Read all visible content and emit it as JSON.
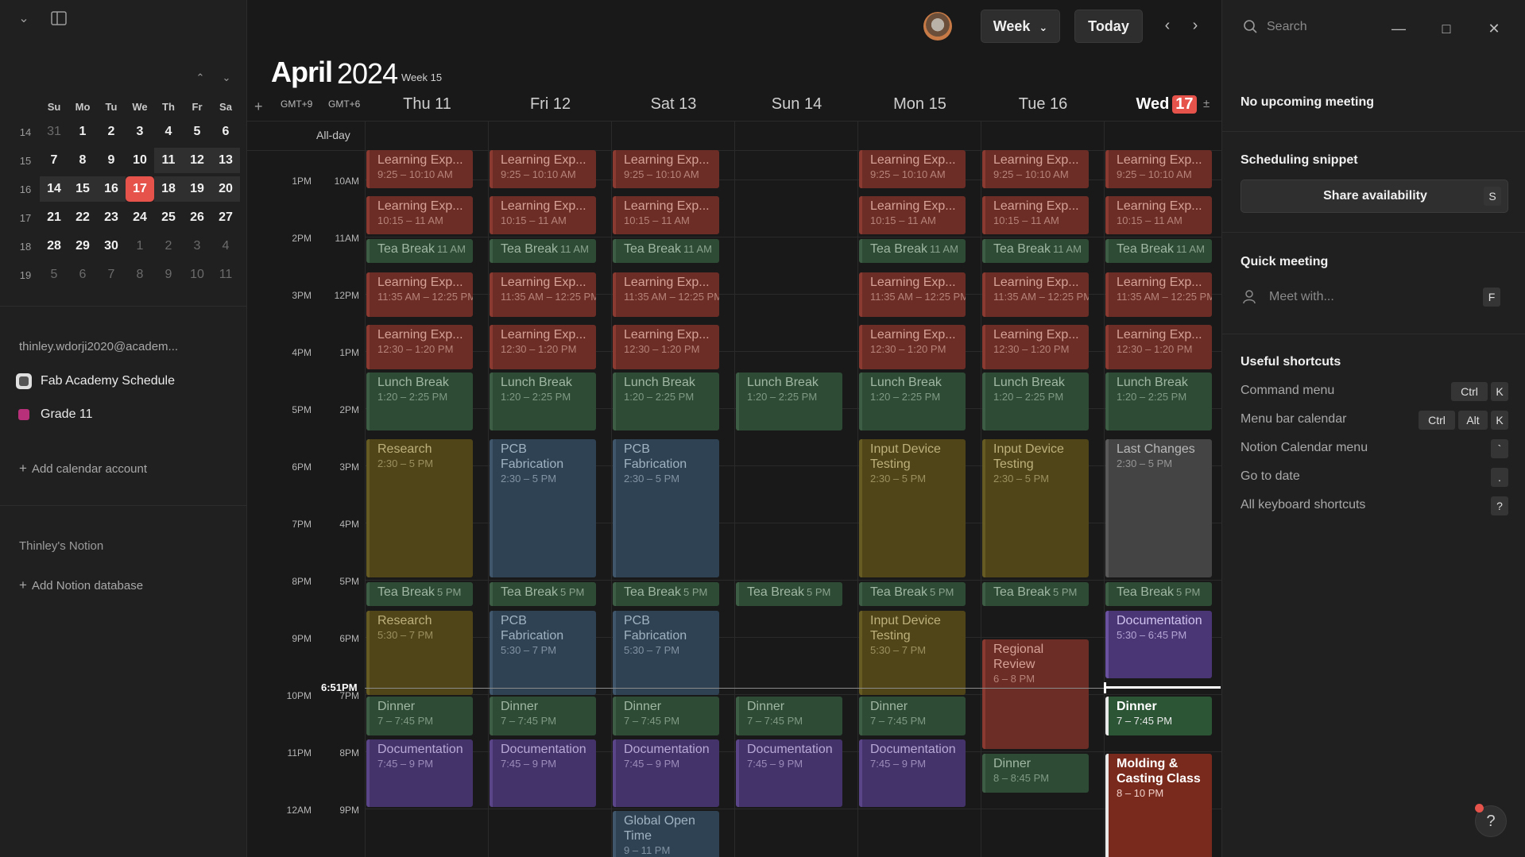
{
  "sidebar": {
    "mini_calendar": {
      "weekday_headers": [
        "Su",
        "Mo",
        "Tu",
        "We",
        "Th",
        "Fr",
        "Sa"
      ],
      "rows": [
        {
          "week": "14",
          "days": [
            "31",
            "1",
            "2",
            "3",
            "4",
            "5",
            "6"
          ]
        },
        {
          "week": "15",
          "days": [
            "7",
            "8",
            "9",
            "10",
            "11",
            "12",
            "13"
          ]
        },
        {
          "week": "16",
          "days": [
            "14",
            "15",
            "16",
            "17",
            "18",
            "19",
            "20"
          ]
        },
        {
          "week": "17",
          "days": [
            "21",
            "22",
            "23",
            "24",
            "25",
            "26",
            "27"
          ]
        },
        {
          "week": "18",
          "days": [
            "28",
            "29",
            "30",
            "1",
            "2",
            "3",
            "4"
          ]
        },
        {
          "week": "19",
          "days": [
            "5",
            "6",
            "7",
            "8",
            "9",
            "10",
            "11"
          ]
        }
      ]
    },
    "account_email": "thinley.wdorji2020@academ...",
    "calendars": [
      {
        "label": "Fab Academy Schedule",
        "color": "#e0e0e0"
      },
      {
        "label": "Grade 11",
        "color": "#d0368a"
      }
    ],
    "add_calendar_account": "Add calendar account",
    "notion_section": "Thinley's Notion",
    "add_notion_database": "Add Notion database"
  },
  "header": {
    "month": "April",
    "year": "2024",
    "week_label": "Week 15",
    "view_select": "Week",
    "today_button": "Today"
  },
  "timezones": [
    "GMT+9",
    "GMT+6"
  ],
  "all_day_label": "All-day",
  "days": [
    {
      "label": "Thu 11"
    },
    {
      "label": "Fri 12"
    },
    {
      "label": "Sat 13"
    },
    {
      "label": "Sun 14"
    },
    {
      "label": "Mon 15"
    },
    {
      "label": "Tue 16"
    },
    {
      "label": "Wed",
      "badge": "17"
    }
  ],
  "time_labels_gmt9": [
    "1PM",
    "2PM",
    "3PM",
    "4PM",
    "5PM",
    "6PM",
    "7PM",
    "8PM",
    "9PM",
    "10PM",
    "11PM",
    "12AM"
  ],
  "time_labels_gmt6": [
    "10AM",
    "11AM",
    "12PM",
    "1PM",
    "2PM",
    "3PM",
    "4PM",
    "5PM",
    "6PM",
    "7PM",
    "8PM",
    "9PM"
  ],
  "current_time": "6:51PM",
  "events": {
    "learn1": {
      "title": "Learning Exp...",
      "time": "9:25 – 10:10 AM"
    },
    "learn2": {
      "title": "Learning Exp...",
      "time": "10:15 – 11 AM"
    },
    "tea1": {
      "title": "Tea Break",
      "time": "11 AM"
    },
    "learn3": {
      "title": "Learning Exp...",
      "time": "11:35 AM – 12:25 PM"
    },
    "learn4": {
      "title": "Learning Exp...",
      "time": "12:30 – 1:20 PM"
    },
    "lunch": {
      "title": "Lunch Break",
      "time": "1:20 – 2:25 PM"
    },
    "research1": {
      "title": "Research",
      "time": "2:30 – 5 PM"
    },
    "pcb1": {
      "title": "PCB Fabrication",
      "time": "2:30 – 5 PM"
    },
    "input1": {
      "title": "Input Device Testing",
      "time": "2:30 – 5 PM"
    },
    "last": {
      "title": "Last Changes",
      "time": "2:30 – 5 PM"
    },
    "tea2": {
      "title": "Tea Break",
      "time": "5 PM"
    },
    "research2": {
      "title": "Research",
      "time": "5:30 – 7 PM"
    },
    "pcb2": {
      "title": "PCB Fabrication",
      "time": "5:30 – 7 PM"
    },
    "input2": {
      "title": "Input Device Testing",
      "time": "5:30 – 7 PM"
    },
    "regional": {
      "title": "Regional Review",
      "time": "6 – 8 PM"
    },
    "doc_wed": {
      "title": "Documentation",
      "time": "5:30 – 6:45 PM"
    },
    "dinner": {
      "title": "Dinner",
      "time": "7 – 7:45 PM"
    },
    "dinner_tue": {
      "title": "Dinner",
      "time": "8 – 8:45 PM"
    },
    "doc": {
      "title": "Documentation",
      "time": "7:45 – 9 PM"
    },
    "global": {
      "title": "Global Open Time",
      "time": "9 – 11 PM"
    },
    "molding": {
      "title": "Molding & Casting Class",
      "time": "8 – 10 PM"
    }
  },
  "right_panel": {
    "search_placeholder": "Search",
    "no_meeting": "No upcoming meeting",
    "snippet_heading": "Scheduling snippet",
    "share_button": "Share availability",
    "share_key": "S",
    "quick_heading": "Quick meeting",
    "meet_placeholder": "Meet with...",
    "meet_key": "F",
    "shortcuts_heading": "Useful shortcuts",
    "shortcuts": [
      {
        "label": "Command menu",
        "keys": [
          "Ctrl",
          "K"
        ]
      },
      {
        "label": "Menu bar calendar",
        "keys": [
          "Ctrl",
          "Alt",
          "K"
        ]
      },
      {
        "label": "Notion Calendar menu",
        "keys": [
          "`"
        ]
      },
      {
        "label": "Go to date",
        "keys": [
          "."
        ]
      },
      {
        "label": "All keyboard shortcuts",
        "keys": [
          "?"
        ]
      }
    ],
    "help": "?"
  }
}
